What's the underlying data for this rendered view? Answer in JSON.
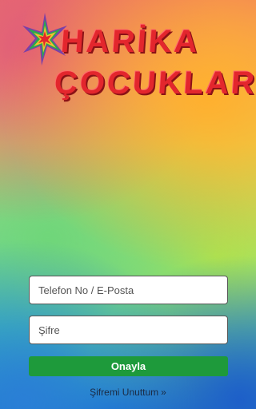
{
  "logo": {
    "line1": "HARİKA",
    "line2": "ÇOCUKLAR"
  },
  "login": {
    "phone_placeholder": "Telefon No / E-Posta",
    "password_placeholder": "Şifre",
    "submit_label": "Onayla",
    "forgot_label": "Şifremi Unuttum",
    "forgot_arrow": "»"
  },
  "colors": {
    "submit_bg": "#1e9a3b",
    "logo_red": "#e3262d"
  }
}
